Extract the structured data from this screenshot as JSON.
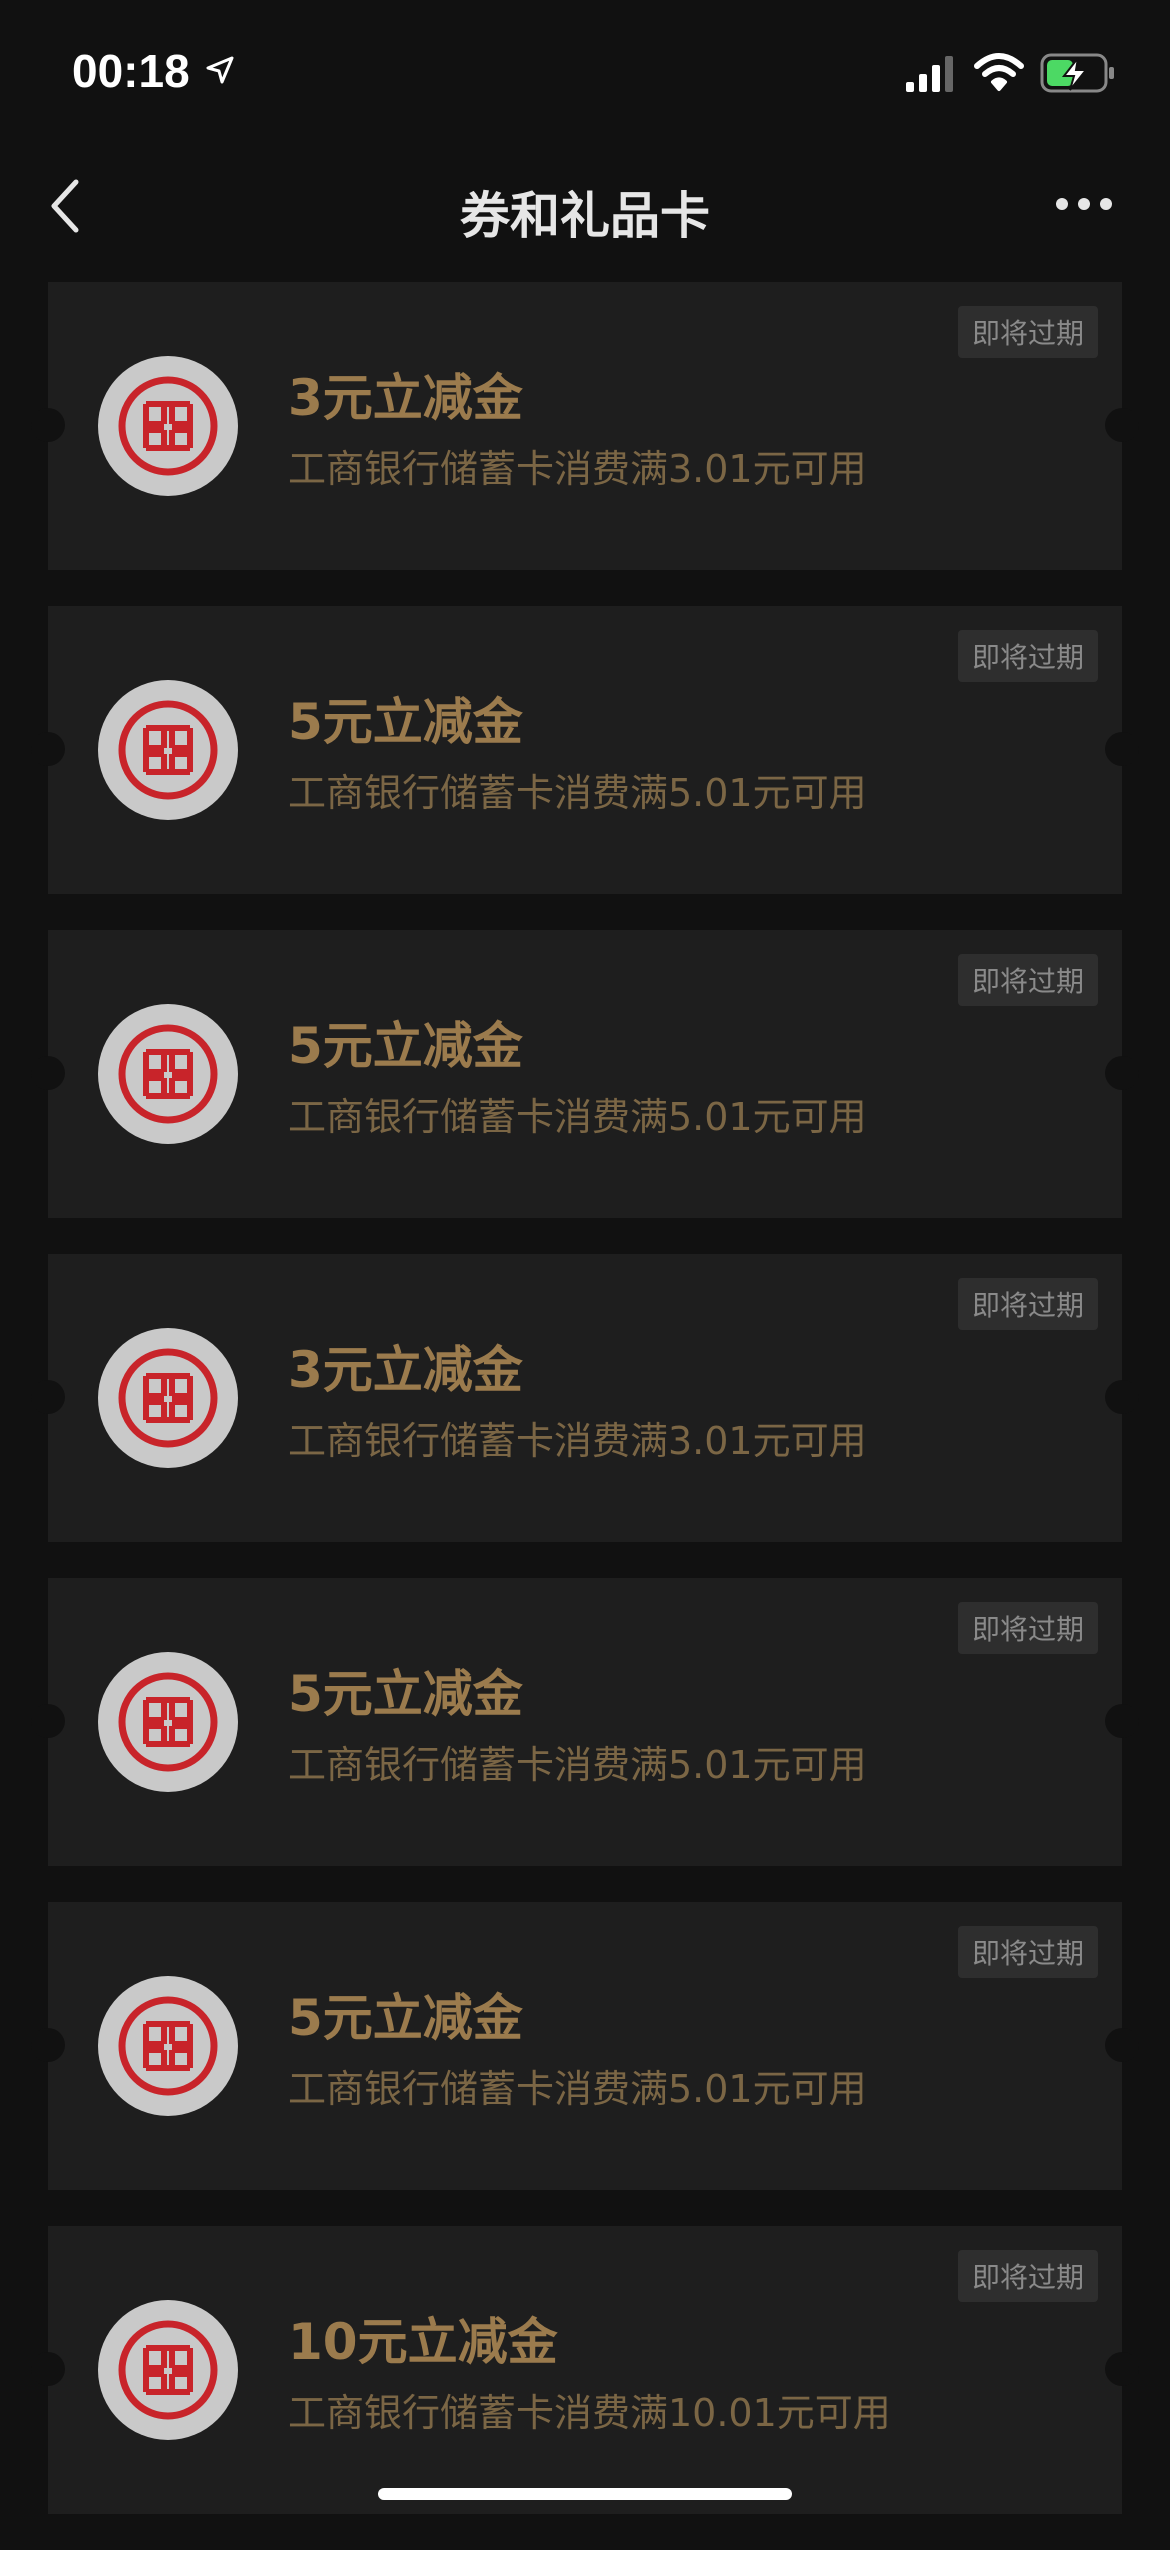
{
  "status": {
    "time": "00:18",
    "icons": [
      "location-arrow-icon",
      "signal-icon",
      "wifi-icon",
      "battery-charging-icon"
    ],
    "battery_color": "#4cd964"
  },
  "nav": {
    "title": "券和礼品卡",
    "back_icon": "chevron-left-icon",
    "more_icon": "more-dots-icon"
  },
  "colors": {
    "background": "#111111",
    "card": "#1e1e1e",
    "title_gold": "#9b7b4d",
    "desc_gold": "#7b6645",
    "logo_red": "#c8242a"
  },
  "coupons": [
    {
      "title": "3元立减金",
      "desc": "工商银行储蓄卡消费满3.01元可用",
      "badge": "即将过期"
    },
    {
      "title": "5元立减金",
      "desc": "工商银行储蓄卡消费满5.01元可用",
      "badge": "即将过期"
    },
    {
      "title": "5元立减金",
      "desc": "工商银行储蓄卡消费满5.01元可用",
      "badge": "即将过期"
    },
    {
      "title": "3元立减金",
      "desc": "工商银行储蓄卡消费满3.01元可用",
      "badge": "即将过期"
    },
    {
      "title": "5元立减金",
      "desc": "工商银行储蓄卡消费满5.01元可用",
      "badge": "即将过期"
    },
    {
      "title": "5元立减金",
      "desc": "工商银行储蓄卡消费满5.01元可用",
      "badge": "即将过期"
    },
    {
      "title": "10元立减金",
      "desc": "工商银行储蓄卡消费满10.01元可用",
      "badge": "即将过期"
    }
  ]
}
